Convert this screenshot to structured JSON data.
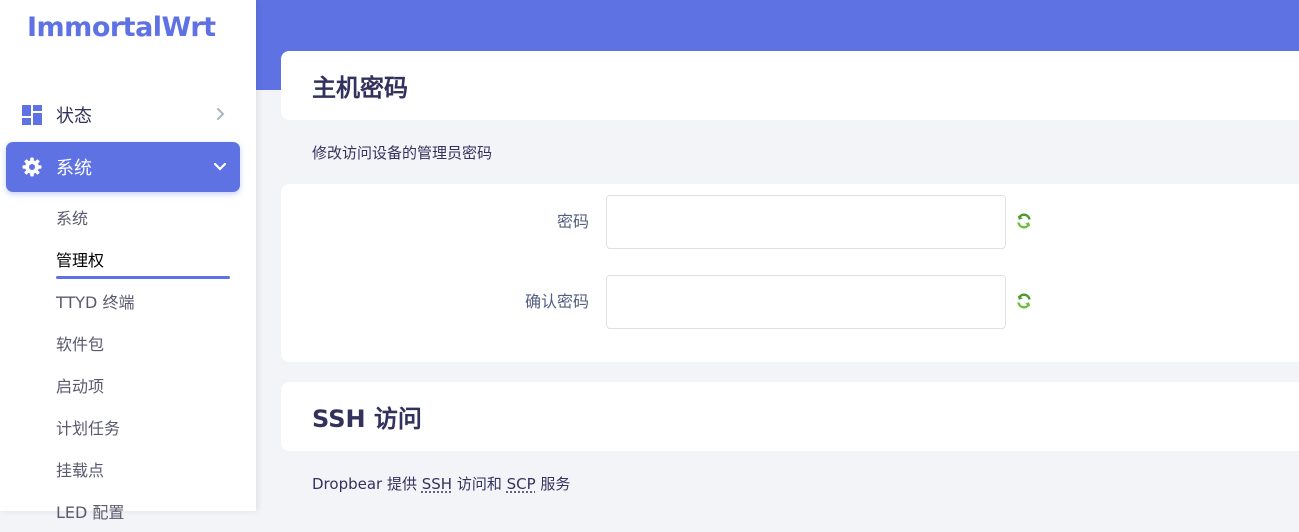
{
  "brand": {
    "logo_text": "ImmortalWrt",
    "accent": "#5e72e4"
  },
  "sidebar": {
    "menu": [
      {
        "label": "状态",
        "icon": "dashboard-icon",
        "expanded": false
      },
      {
        "label": "系统",
        "icon": "gear-icon",
        "expanded": true
      }
    ],
    "submenu": [
      {
        "label": "系统"
      },
      {
        "label": "管理权",
        "active": true
      },
      {
        "label": "TTYD 终端"
      },
      {
        "label": "软件包"
      },
      {
        "label": "启动项"
      },
      {
        "label": "计划任务"
      },
      {
        "label": "挂载点"
      },
      {
        "label": "LED 配置"
      }
    ]
  },
  "password_section": {
    "title": "主机密码",
    "description": "修改访问设备的管理员密码",
    "fields": [
      {
        "label": "密码",
        "value": "",
        "icon": "reveal-password-icon"
      },
      {
        "label": "确认密码",
        "value": "",
        "icon": "reveal-password-icon"
      }
    ]
  },
  "ssh_section": {
    "title": "SSH 访问",
    "description_prefix": "Dropbear 提供 ",
    "ssh_abbr": "SSH",
    "description_middle": " 访问和 ",
    "scp_abbr": "SCP",
    "description_suffix": " 服务"
  }
}
